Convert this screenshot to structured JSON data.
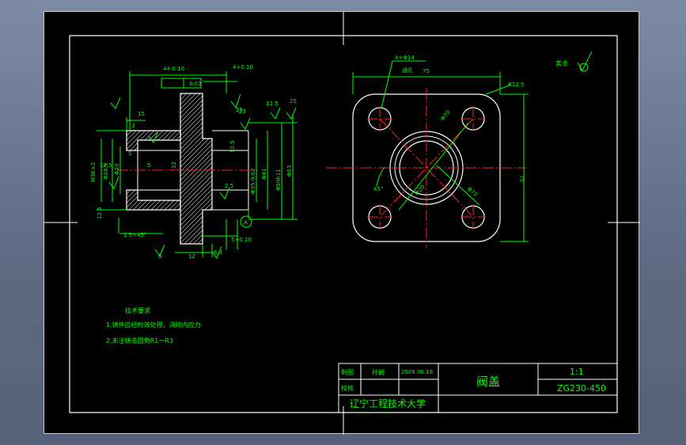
{
  "title_block": {
    "drawn_label": "制图",
    "drawn_by": "孙娟",
    "date": "2008.06.18",
    "checked_label": "校核",
    "part_name": "阀盖",
    "scale": "1:1",
    "drawing_number": "ZG230-450",
    "school": "辽宁工程技术大学"
  },
  "tech_requirements": {
    "heading": "技术要求",
    "items": [
      "1.铸件应经时效处理，消除内应力",
      "2.未注铸造圆角R1～R3"
    ]
  },
  "surface_finish_note": "其余",
  "section_view": {
    "labels": [
      "44-0.10",
      "4+0.10",
      "0.03",
      "15",
      "25",
      "23",
      "12.5",
      "25",
      "3",
      "M36×2",
      "Φ28.5",
      "Φ20",
      "5",
      "32",
      "Φ35-0.02",
      "Φ41",
      "Φ50h11",
      "Φ53",
      "12.5",
      "2.5",
      "5",
      "12.5",
      "1.5×45°",
      "6",
      "12",
      "5+0.10",
      "6.3",
      "A",
      "12.5"
    ]
  },
  "top_view": {
    "labels": [
      "4×Φ14",
      "通孔",
      "75",
      "R12.5",
      "75",
      "Φ70",
      "45°",
      "Φ70",
      "Φ20"
    ]
  },
  "colors": {
    "frame": "#ffffff",
    "dimension": "#00ff00",
    "center_line": "#ff2020",
    "outline": "#ffffff",
    "hatch": "#ffffff",
    "title_text": "#00ff00"
  }
}
